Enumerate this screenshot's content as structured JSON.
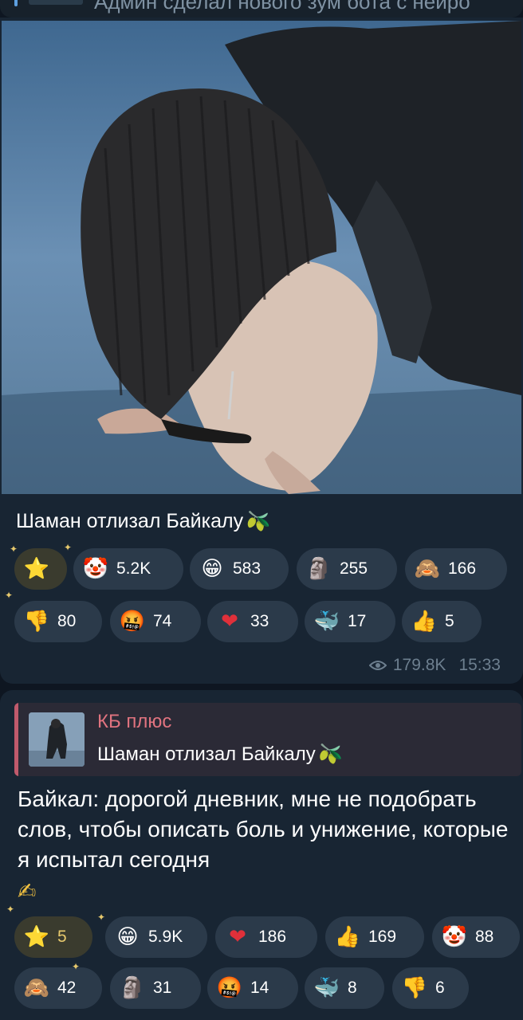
{
  "previous_message": {
    "text": "Админ сделал нового зум бота с нейро"
  },
  "post": {
    "text": "Шаман отлизал Байкалу",
    "text_emoji": "🫒",
    "reactions_row1": [
      {
        "icon": "star-icon",
        "emoji": "⭐",
        "count": ""
      },
      {
        "icon": "clown-icon",
        "emoji": "🤡",
        "count": "5.2K"
      },
      {
        "icon": "grin-icon",
        "emoji": "😁",
        "count": "583"
      },
      {
        "icon": "moai-icon",
        "emoji": "🗿",
        "count": "255"
      },
      {
        "icon": "see-no-evil-monkey-icon",
        "emoji": "🙈",
        "count": "166"
      }
    ],
    "reactions_row2": [
      {
        "icon": "thumbs-down-icon",
        "emoji": "👎",
        "count": "80"
      },
      {
        "icon": "cursing-face-icon",
        "emoji": "🤬",
        "count": "74"
      },
      {
        "icon": "heart-icon",
        "emoji": "❤",
        "count": "33"
      },
      {
        "icon": "whale-icon",
        "emoji": "🐳",
        "count": "17"
      },
      {
        "icon": "thumbs-up-icon",
        "emoji": "👍",
        "count": "5"
      }
    ],
    "views": "179.8K",
    "time": "15:33"
  },
  "reply": {
    "quote_title": "КБ плюс",
    "quote_text": "Шаман отлизал Байкалу",
    "quote_emoji": "🫒",
    "text": "Байкал: дорогой дневник, мне не подобрать слов, чтобы описать боль и унижение, которые я испытал сегодня",
    "text_emoji": "✍",
    "reactions_row1": [
      {
        "icon": "star-icon",
        "emoji": "⭐",
        "count": "5"
      },
      {
        "icon": "grin-icon",
        "emoji": "😁",
        "count": "5.9K"
      },
      {
        "icon": "heart-icon",
        "emoji": "❤",
        "count": "186"
      },
      {
        "icon": "thumbs-up-icon",
        "emoji": "👍",
        "count": "169"
      },
      {
        "icon": "clown-icon",
        "emoji": "🤡",
        "count": "88"
      }
    ],
    "reactions_row2": [
      {
        "icon": "see-no-evil-monkey-icon",
        "emoji": "🙈",
        "count": "42"
      },
      {
        "icon": "moai-icon",
        "emoji": "🗿",
        "count": "31"
      },
      {
        "icon": "cursing-face-icon",
        "emoji": "🤬",
        "count": "14"
      },
      {
        "icon": "whale-icon",
        "emoji": "🐳",
        "count": "8"
      },
      {
        "icon": "thumbs-down-icon",
        "emoji": "👎",
        "count": "6"
      }
    ]
  },
  "colors": {
    "background": "#0e1621",
    "bubble": "#182533",
    "chip": "#2b3a4a",
    "meta": "#6d7f8f",
    "quote_accent": "#e0737f"
  }
}
